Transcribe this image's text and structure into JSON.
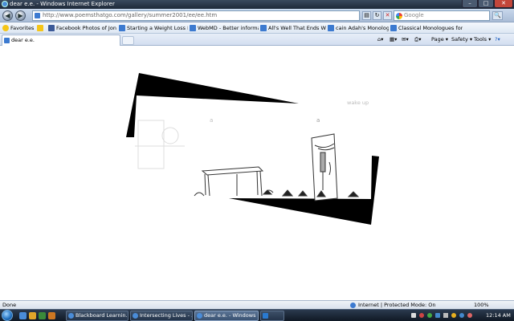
{
  "window": {
    "title": "dear e.e. - Windows Internet Explorer",
    "controls": {
      "minimize": "–",
      "maximize": "□",
      "close": "✕"
    }
  },
  "nav": {
    "back": "◀",
    "forward": "▶",
    "address": "http://www.poemsthatgo.com/gallery/summer2001/ee/ee.htm",
    "refresh": "↻",
    "stop": "✕",
    "search_placeholder": "Google",
    "search_go": "🔍"
  },
  "favorites": {
    "label": "Favorites",
    "items": [
      "Facebook  Photos of Jon ...",
      "Starting a Weight Loss Pla...",
      "WebMD - Better informati...",
      "All's Well That Ends Well ...",
      "cain Adah's Monologue",
      "Classical Monologues for ..."
    ]
  },
  "tab": {
    "title": "dear e.e."
  },
  "commandbar": {
    "page": "Page ▾",
    "safety": "Safety ▾",
    "tools": "Tools ▾",
    "help": "?▾"
  },
  "content": {
    "text_a1": "a",
    "text_a2": "a",
    "text_wakeup": "wake up"
  },
  "status": {
    "left": "Done",
    "zone": "Internet | Protected Mode: On",
    "zoom": "100%"
  },
  "taskbar": {
    "tasks": [
      "Blackboard Learnin...",
      "Intersecting Lives - ...",
      "dear e.e. - Windows ...",
      ""
    ],
    "clock": "12:14 AM"
  }
}
